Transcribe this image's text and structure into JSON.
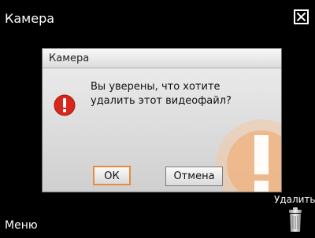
{
  "app": {
    "title": "Камера"
  },
  "dialog": {
    "title": "Камера",
    "message_line1": "Вы уверены, что хотите",
    "message_line2": "удалить этот видеофайл?",
    "ok_label": "ОК",
    "cancel_label": "Отмена"
  },
  "softkeys": {
    "left": "Меню",
    "right": "Удалить"
  },
  "icons": {
    "close": "close-icon",
    "error": "error-icon",
    "warning_watermark": "warning-icon",
    "trash": "trash-icon"
  },
  "colors": {
    "background": "#000000",
    "error_red": "#d9261c",
    "accent_orange": "#e98a3f"
  }
}
